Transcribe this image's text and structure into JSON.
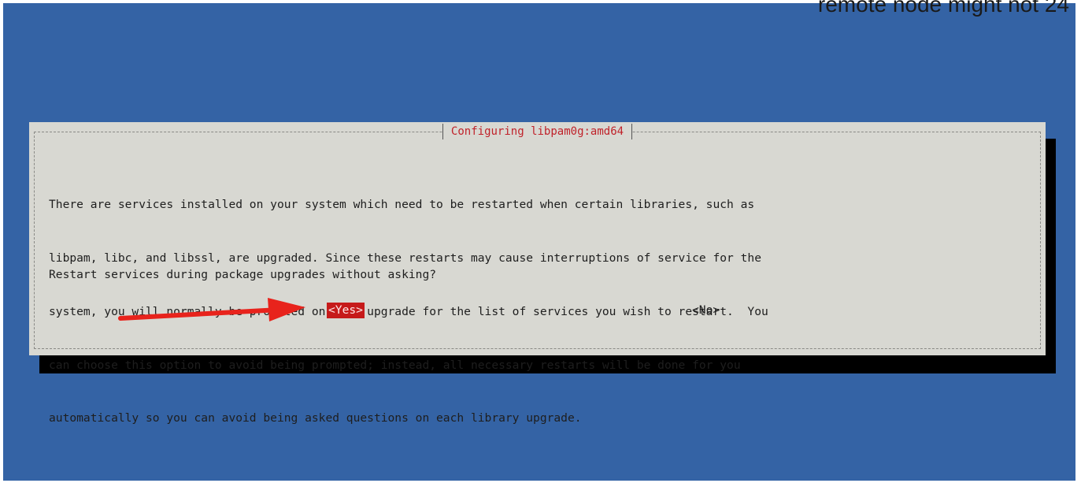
{
  "overflow_caption": "remote node might not 24",
  "dialog": {
    "title": "Configuring libpam0g:amd64",
    "message_lines": [
      "There are services installed on your system which need to be restarted when certain libraries, such as",
      "libpam, libc, and libssl, are upgraded. Since these restarts may cause interruptions of service for the",
      "system, you will normally be prompted on each upgrade for the list of services you wish to restart.  You",
      "can choose this option to avoid being prompted; instead, all necessary restarts will be done for you",
      "automatically so you can avoid being asked questions on each library upgrade."
    ],
    "question": "Restart services during package upgrades without asking?",
    "yes_label": "<Yes>",
    "no_label": "<No>",
    "selected": "yes"
  },
  "colors": {
    "background": "#3463a5",
    "dialog": "#d8d8d2",
    "title": "#c0222a",
    "selected_button": "#c61a1a",
    "annotation_arrow": "#e8231c"
  },
  "annotation": {
    "icon": "red-arrow-icon",
    "points_to": "yes-button"
  }
}
